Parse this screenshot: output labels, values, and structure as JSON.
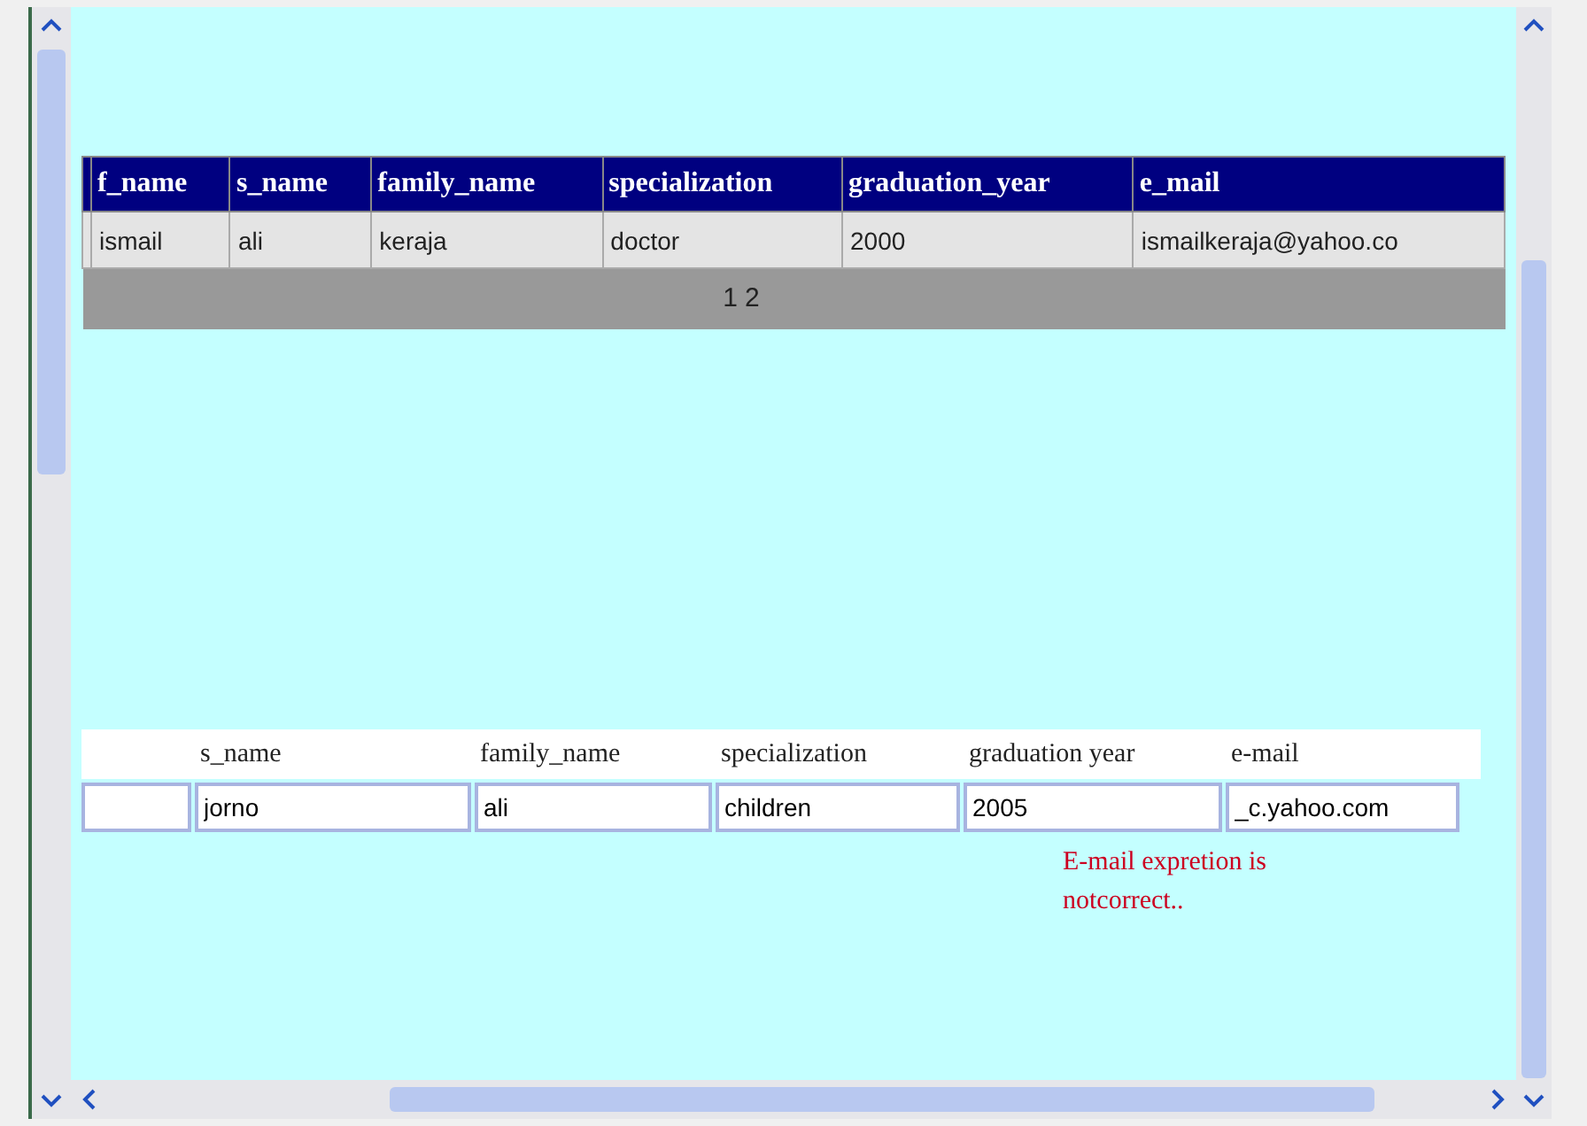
{
  "table": {
    "columns": [
      "f_name",
      "s_name",
      "family_name",
      "specialization",
      "graduation_year",
      "e_mail"
    ],
    "rows": [
      [
        "ismail",
        "ali",
        "keraja",
        "doctor",
        "2000",
        "ismailkeraja@yahoo.co"
      ]
    ],
    "pager": [
      "1",
      "2"
    ]
  },
  "form": {
    "fields": [
      {
        "label": "s_name",
        "value": "jorno"
      },
      {
        "label": "family_name",
        "value": "ali"
      },
      {
        "label": "specialization",
        "value": "children"
      },
      {
        "label": "graduation year",
        "value": "2005"
      },
      {
        "label": "e-mail",
        "value": "_c.yahoo.com"
      }
    ]
  },
  "error": "E-mail expretion is notcorrect.."
}
